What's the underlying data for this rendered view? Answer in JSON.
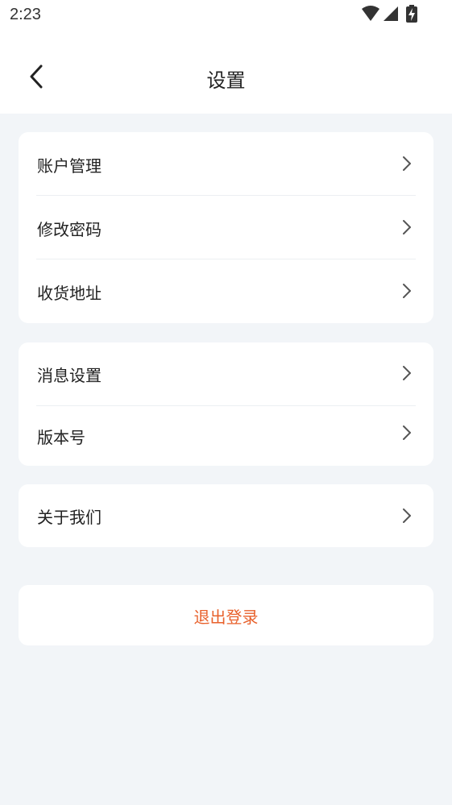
{
  "status_bar": {
    "time": "2:23",
    "icons": [
      "wifi-icon",
      "cellular-signal-icon",
      "battery-charging-icon"
    ]
  },
  "header": {
    "back_icon": "chevron-left-icon",
    "title": "设置"
  },
  "settings_groups": [
    {
      "items": [
        {
          "label": "账户管理",
          "icon": "chevron-right-icon"
        },
        {
          "label": "修改密码",
          "icon": "chevron-right-icon"
        },
        {
          "label": "收货地址",
          "icon": "chevron-right-icon"
        }
      ]
    },
    {
      "items": [
        {
          "label": "消息设置",
          "icon": "chevron-right-icon"
        },
        {
          "label": "版本号",
          "icon": "chevron-right-icon"
        }
      ]
    },
    {
      "items": [
        {
          "label": "关于我们",
          "icon": "chevron-right-icon"
        }
      ]
    }
  ],
  "logout": {
    "label": "退出登录"
  },
  "colors": {
    "page_background": "#f2f5f8",
    "card_background": "#ffffff",
    "text_primary": "#222222",
    "chevron": "#555555",
    "divider": "#eceff2",
    "logout_text": "#e8612c"
  }
}
